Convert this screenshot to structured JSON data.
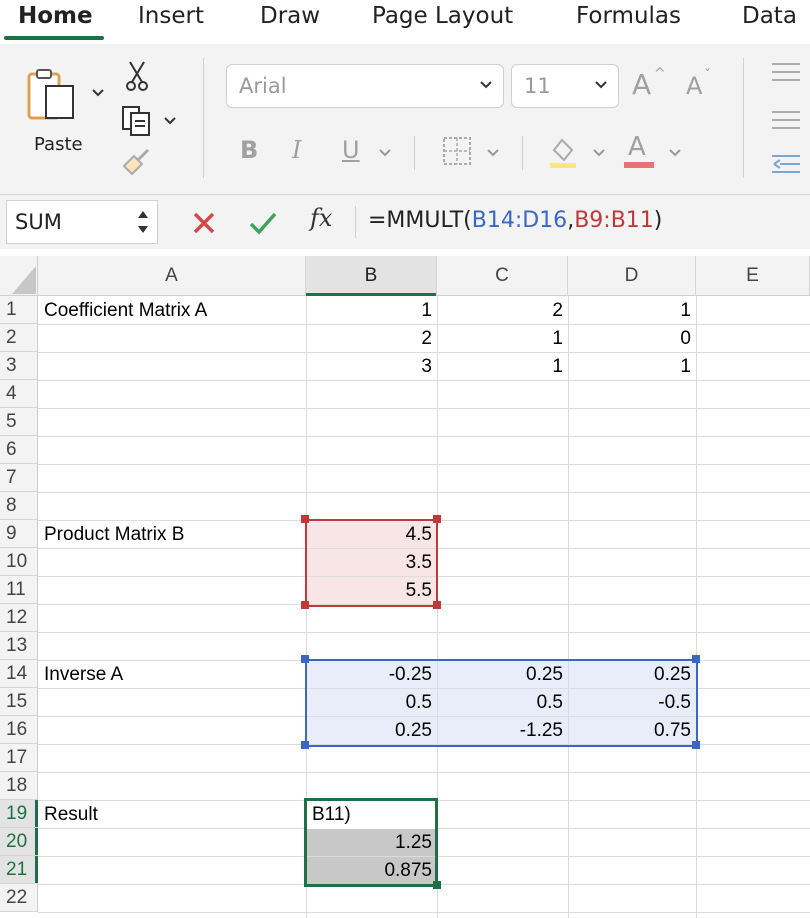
{
  "tabs": [
    "Home",
    "Insert",
    "Draw",
    "Page Layout",
    "Formulas",
    "Data"
  ],
  "active_tab": "Home",
  "ribbon": {
    "paste_label": "Paste",
    "font_name": "Arial",
    "font_size": "11",
    "bold": "B",
    "italic": "I",
    "underline": "U",
    "increase_font": "A",
    "decrease_font": "A",
    "font_color": "A"
  },
  "formula_bar": {
    "name_box": "SUM",
    "fx": "fx",
    "formula_prefix": "=MMULT(",
    "ref1": "B14:D16",
    "comma": ",",
    "ref2": "B9:B11",
    "formula_suffix": ")"
  },
  "columns": [
    "A",
    "B",
    "C",
    "D",
    "E"
  ],
  "rows": [
    "1",
    "2",
    "3",
    "4",
    "5",
    "6",
    "7",
    "8",
    "9",
    "10",
    "11",
    "12",
    "13",
    "14",
    "15",
    "16",
    "17",
    "18",
    "19",
    "20",
    "21",
    "22"
  ],
  "cells": {
    "A1": "Coefficient Matrix A",
    "B1": "1",
    "C1": "2",
    "D1": "1",
    "B2": "2",
    "C2": "1",
    "D2": "0",
    "B3": "3",
    "C3": "1",
    "D3": "1",
    "A9": "Product Matrix B",
    "B9": "4.5",
    "B10": "3.5",
    "B11": "5.5",
    "A14": "Inverse A",
    "B14": "-0.25",
    "C14": "0.25",
    "D14": "0.25",
    "B15": "0.5",
    "C15": "0.5",
    "D15": "-0.5",
    "B16": "0.25",
    "C16": "-1.25",
    "D16": "0.75",
    "A19": "Result",
    "B19": "B11)",
    "B20": "1.25",
    "B21": "0.875"
  },
  "colors": {
    "accent_green": "#1e7145",
    "ref_red": "#c0393a",
    "ref_blue": "#3a66c4"
  }
}
